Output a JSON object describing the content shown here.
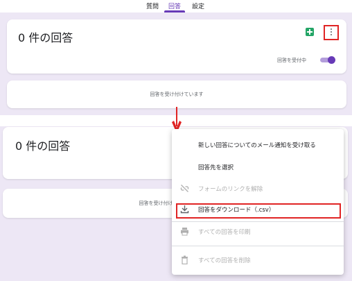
{
  "tabs": [
    {
      "label": "質問",
      "active": false
    },
    {
      "label": "回答",
      "active": true
    },
    {
      "label": "設定",
      "active": false
    }
  ],
  "responses": {
    "count_title": "0 件の回答",
    "accepting_label": "回答を受付中",
    "accepting_enabled": true,
    "status_message": "回答を受け付けています"
  },
  "menu": {
    "items": [
      {
        "label": "新しい回答についてのメール通知を受け取る",
        "enabled": true,
        "icon": ""
      },
      {
        "label": "回答先を選択",
        "enabled": true,
        "icon": ""
      },
      {
        "label": "フォームのリンクを解除",
        "enabled": false,
        "icon": "unlink-icon"
      },
      {
        "label": "回答をダウンロード（.csv）",
        "enabled": true,
        "icon": "download-icon"
      },
      {
        "label": "すべての回答を印刷",
        "enabled": false,
        "icon": "print-icon"
      },
      {
        "label": "すべての回答を削除",
        "enabled": false,
        "icon": "trash-icon"
      }
    ]
  },
  "colors": {
    "accent": "#673ab7",
    "highlight": "#e02424",
    "sheets_green": "#23a566",
    "background": "#ede7f5"
  }
}
